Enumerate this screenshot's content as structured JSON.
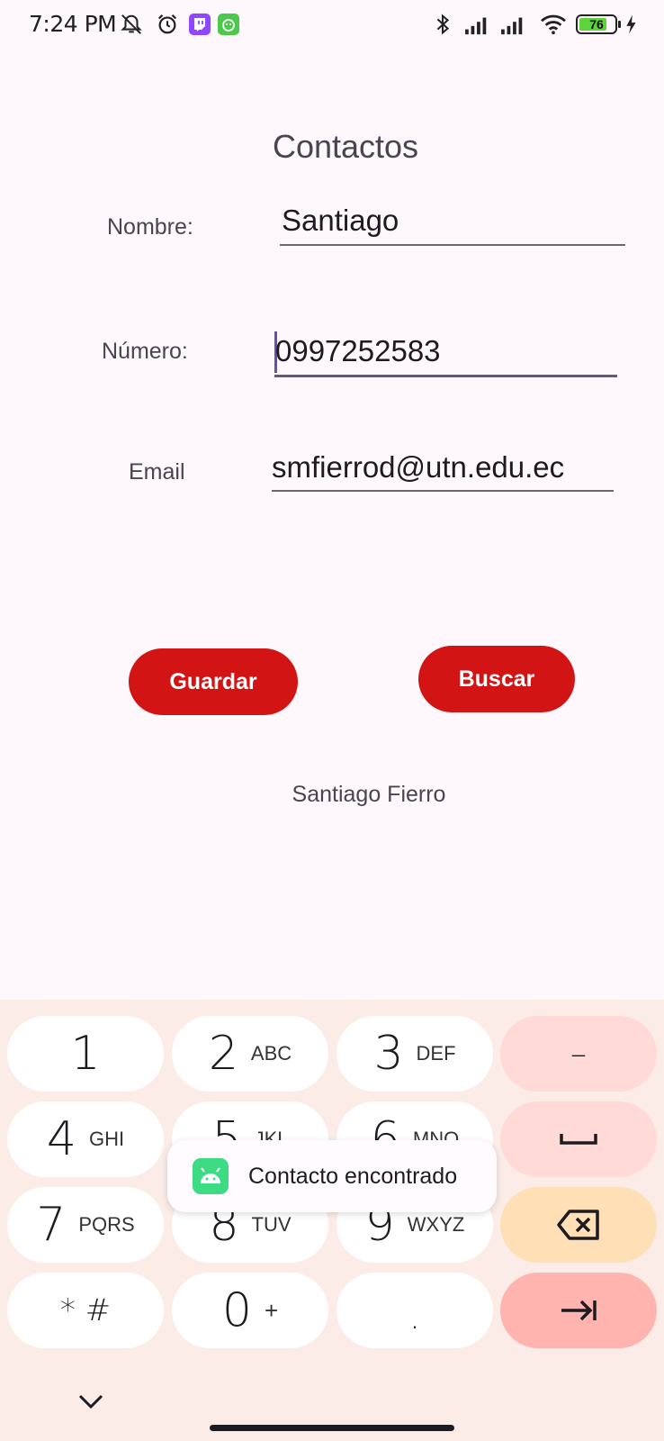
{
  "status_bar": {
    "time": "7:24 PM",
    "battery": "76",
    "icons": [
      "mute-icon",
      "alarm-icon",
      "twitch-icon",
      "app-icon",
      "bluetooth-icon",
      "signal-icon",
      "signal-icon",
      "wifi-icon",
      "battery-icon",
      "charging-icon"
    ]
  },
  "form": {
    "title": "Contactos",
    "name_label": "Nombre:",
    "name_value": "Santiago",
    "number_label": "Número:",
    "number_value": "0997252583",
    "email_label": "Email",
    "email_value": "smfierrod@utn.edu.ec",
    "save_button": "Guardar",
    "search_button": "Buscar",
    "result_text": "Santiago Fierro"
  },
  "toast": {
    "text": "Contacto encontrado",
    "icon": "android-icon"
  },
  "keyboard": {
    "rows": [
      [
        {
          "num": "1",
          "sub": ""
        },
        {
          "num": "2",
          "sub": "ABC"
        },
        {
          "num": "3",
          "sub": "DEF"
        },
        {
          "num": "–",
          "sub": ""
        }
      ],
      [
        {
          "num": "4",
          "sub": "GHI"
        },
        {
          "num": "5",
          "sub": "JKL"
        },
        {
          "num": "6",
          "sub": "MNO"
        },
        {
          "num": "␣",
          "sub": ""
        }
      ],
      [
        {
          "num": "7",
          "sub": "PQRS"
        },
        {
          "num": "8",
          "sub": "TUV"
        },
        {
          "num": "9",
          "sub": "WXYZ"
        },
        {
          "num": "⌫",
          "sub": ""
        }
      ],
      [
        {
          "num": "* #",
          "sub": ""
        },
        {
          "num": "0",
          "sub": "+"
        },
        {
          "num": ".",
          "sub": ""
        },
        {
          "num": "→|",
          "sub": ""
        }
      ]
    ],
    "colors": {
      "key": "#ffffff",
      "func": "#ffdad6",
      "backspace": "#ffdfb6",
      "enter": "#ffb4b0"
    }
  },
  "colors": {
    "accent": "#d21414",
    "background": "#fef7fc"
  }
}
